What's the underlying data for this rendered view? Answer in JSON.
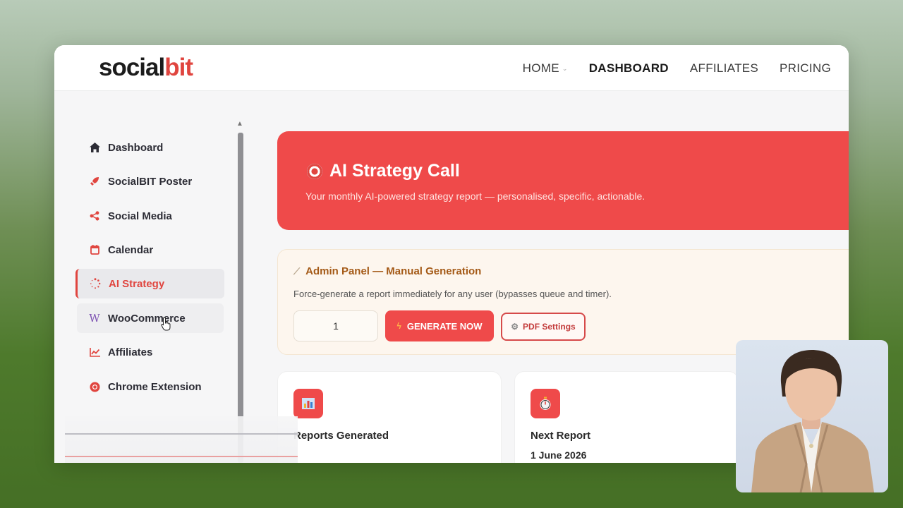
{
  "app": {
    "logo_part1": "social",
    "logo_part2": "bit"
  },
  "nav": [
    {
      "label": "HOME",
      "has_dropdown": true
    },
    {
      "label": "DASHBOARD",
      "active": true
    },
    {
      "label": "AFFILIATES"
    },
    {
      "label": "PRICING"
    }
  ],
  "sidebar": {
    "items": [
      {
        "label": "Dashboard",
        "icon": "home-icon"
      },
      {
        "label": "SocialBIT Poster",
        "icon": "rocket-icon"
      },
      {
        "label": "Social Media",
        "icon": "share-icon"
      },
      {
        "label": "Calendar",
        "icon": "calendar-icon"
      },
      {
        "label": "AI Strategy",
        "icon": "spinner-icon",
        "active": true
      },
      {
        "label": "WooCommerce",
        "icon": "woocommerce-icon"
      },
      {
        "label": "Affiliates",
        "icon": "chart-line-icon"
      },
      {
        "label": "Chrome Extension",
        "icon": "chrome-icon"
      }
    ]
  },
  "hero": {
    "title": "AI Strategy Call",
    "subtitle": "Your monthly AI-powered strategy report — personalised, specific, actionable."
  },
  "admin": {
    "title": "Admin Panel — Manual Generation",
    "description": "Force-generate a report immediately for any user (bypasses queue and timer).",
    "user_id_value": "1",
    "generate_label": "GENERATE NOW",
    "pdf_label": "PDF Settings"
  },
  "cards": [
    {
      "label": "Reports Generated",
      "value": "",
      "icon": "bar-chart-icon"
    },
    {
      "label": "Next Report",
      "value": "1 June 2026",
      "icon": "stopwatch-icon"
    }
  ],
  "colors": {
    "accent": "#ef4a4a",
    "admin_title": "#a45a17",
    "admin_bg": "#fdf6ee"
  }
}
